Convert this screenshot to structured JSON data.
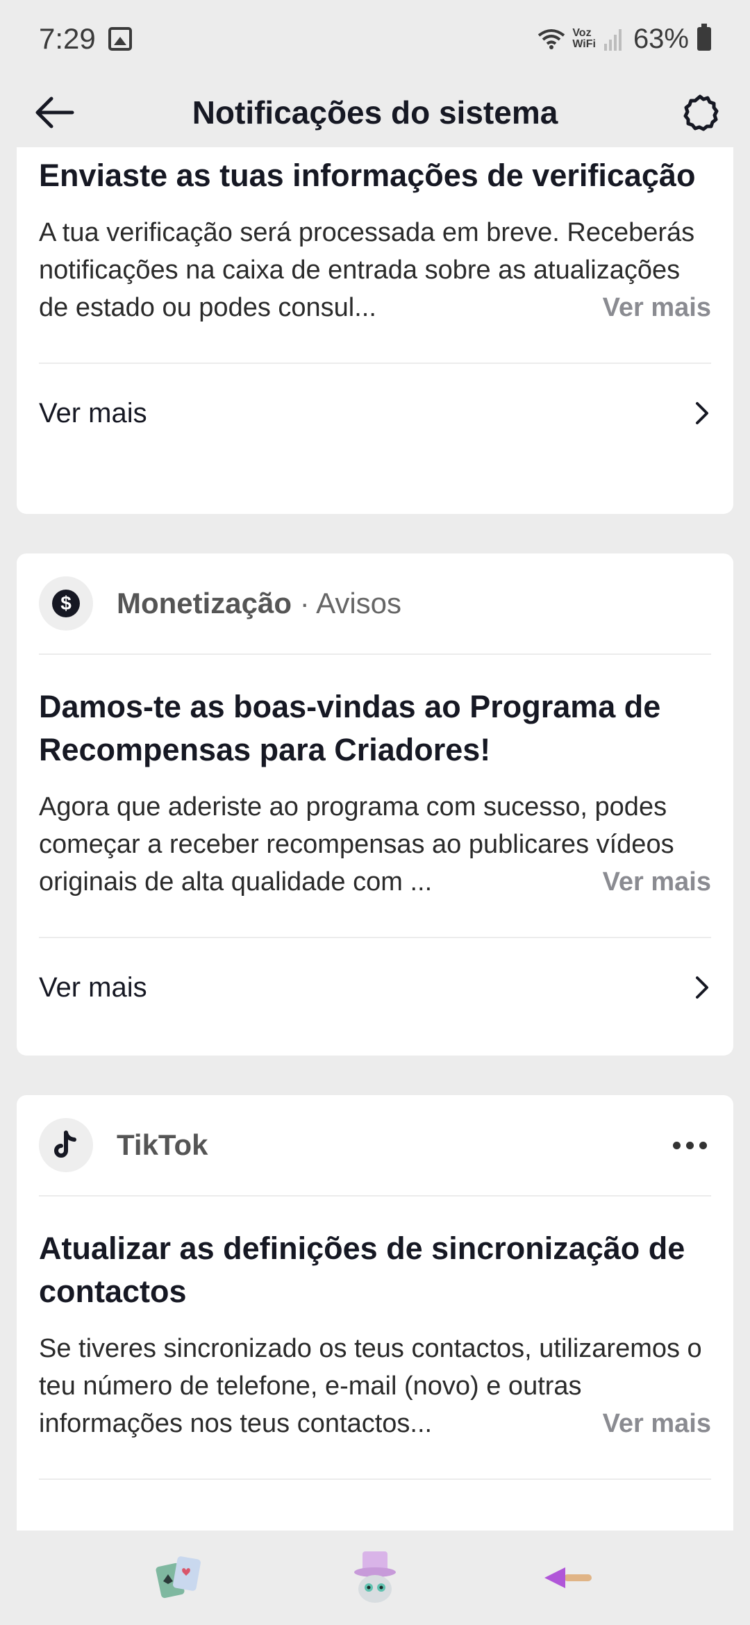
{
  "status_bar": {
    "time": "7:29",
    "wifi_label_top": "Voz",
    "wifi_label_bottom": "WiFi",
    "battery": "63%"
  },
  "header": {
    "title": "Notificações do sistema"
  },
  "cards": [
    {
      "title": "Enviaste as tuas informações de verificação",
      "body": "A tua verificação será processada em breve. Receberás notificações na caixa de entrada sobre as atualizações de estado ou podes consul...",
      "inline_more": "Ver mais",
      "footer": "Ver mais"
    },
    {
      "source": "Monetização",
      "separator": " · ",
      "category": "Avisos",
      "title": "Damos-te as boas-vindas ao Programa de Recompensas para Criadores!",
      "body": "Agora que aderiste ao programa com sucesso, podes começar a receber recompensas ao publicares vídeos originais de alta qualidade com ...",
      "inline_more": "Ver mais",
      "footer": "Ver mais"
    },
    {
      "source": "TikTok",
      "title": "Atualizar as definições de sincronização de contactos",
      "body": "Se tiveres sincronizado os teus contactos, utilizaremos o teu número de telefone, e-mail (novo) e outras informações nos teus contactos...",
      "inline_more": "Ver mais"
    }
  ],
  "icons": {
    "back": "arrow-left-icon",
    "settings": "gear-icon",
    "monetization": "dollar-icon",
    "tiktok": "tiktok-logo-icon",
    "more": "more-horizontal-icon",
    "chevron": "chevron-right-icon"
  },
  "colors": {
    "background": "#ececec",
    "card": "#ffffff",
    "text": "#161823",
    "muted": "#8a8b91"
  }
}
